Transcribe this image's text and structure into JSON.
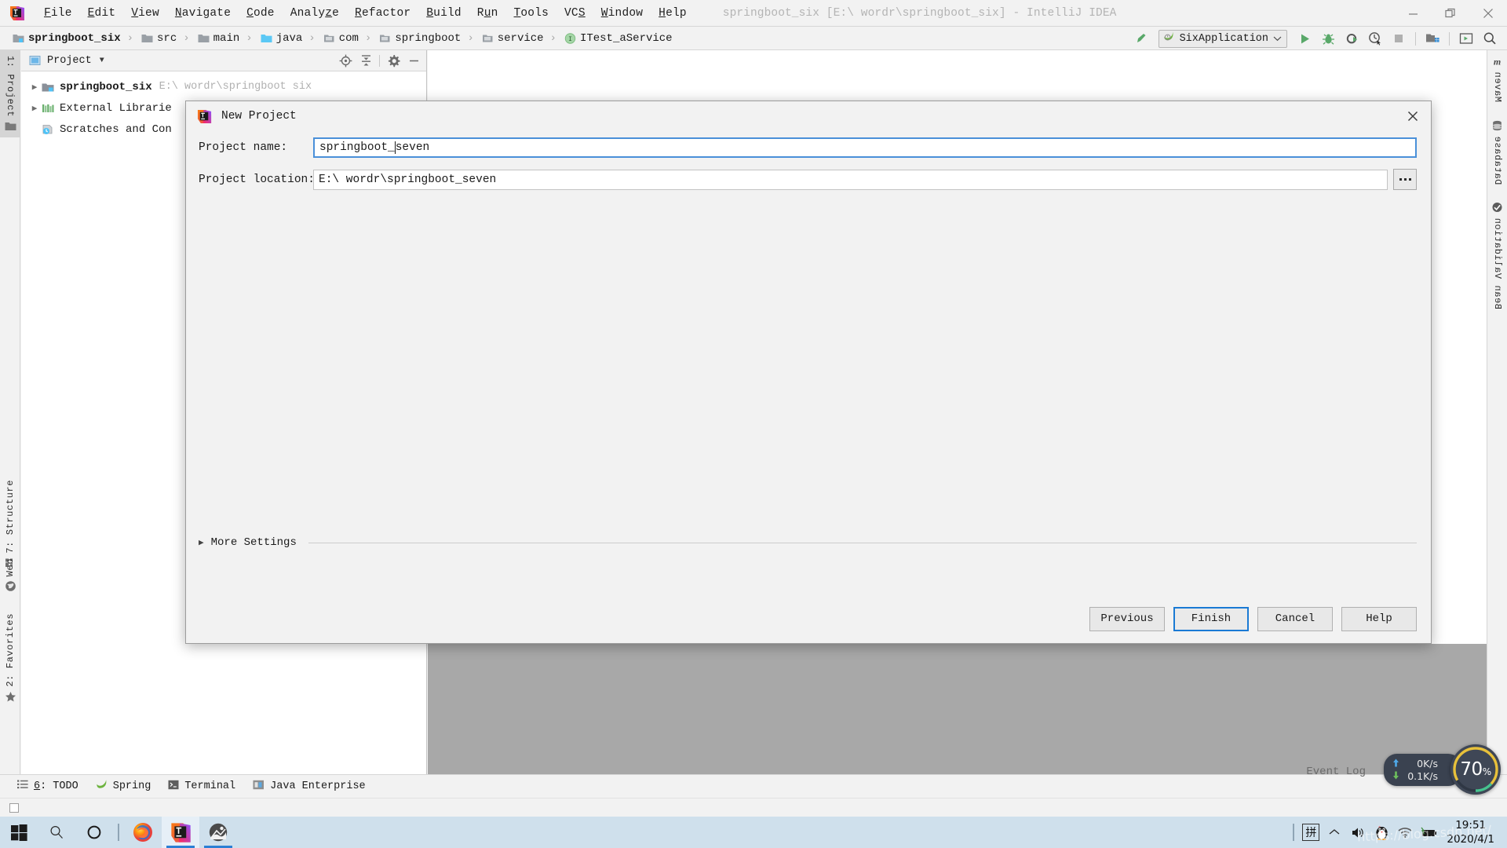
{
  "window": {
    "title": "springboot_six [E:\\ wordr\\springboot_six] - IntelliJ IDEA",
    "minimize_label": "minimize",
    "restore_label": "restore",
    "close_label": "close"
  },
  "menu": {
    "items": [
      {
        "label": "File",
        "mnemonic": "F"
      },
      {
        "label": "Edit",
        "mnemonic": "E"
      },
      {
        "label": "View",
        "mnemonic": "V"
      },
      {
        "label": "Navigate",
        "mnemonic": "N"
      },
      {
        "label": "Code",
        "mnemonic": "C"
      },
      {
        "label": "Analyze",
        "mnemonic": "z"
      },
      {
        "label": "Refactor",
        "mnemonic": "R"
      },
      {
        "label": "Build",
        "mnemonic": "B"
      },
      {
        "label": "Run",
        "mnemonic": "u"
      },
      {
        "label": "Tools",
        "mnemonic": "T"
      },
      {
        "label": "VCS",
        "mnemonic": "S"
      },
      {
        "label": "Window",
        "mnemonic": "W"
      },
      {
        "label": "Help",
        "mnemonic": "H"
      }
    ]
  },
  "breadcrumb": {
    "items": [
      {
        "label": "springboot_six",
        "icon": "project-folder-icon"
      },
      {
        "label": "src",
        "icon": "folder-icon"
      },
      {
        "label": "main",
        "icon": "folder-icon"
      },
      {
        "label": "java",
        "icon": "source-folder-icon"
      },
      {
        "label": "com",
        "icon": "package-icon"
      },
      {
        "label": "springboot",
        "icon": "package-icon"
      },
      {
        "label": "service",
        "icon": "package-icon"
      },
      {
        "label": "ITest_aService",
        "icon": "interface-icon"
      }
    ],
    "separator": "›"
  },
  "toolbar": {
    "build_label": "build-icon",
    "run_configuration": "SixApplication",
    "run_label": "run-icon",
    "debug_label": "debug-icon",
    "run_coverage_label": "run-with-coverage-icon",
    "profile_label": "profiler-icon",
    "stop_label": "stop-icon",
    "project_structure_label": "project-structure-icon",
    "updates_label": "open-tool-window-icon",
    "search_label": "search-everywhere-icon"
  },
  "project_panel": {
    "title": "Project",
    "dropdown": "▼",
    "tools": [
      "locate-icon",
      "collapse-all-icon",
      "settings-gear-icon",
      "hide-icon"
    ],
    "tree": [
      {
        "label": "springboot_six",
        "path": "E:\\ wordr\\springboot six",
        "bold": true,
        "expandable": true,
        "icon": "project-root-icon"
      },
      {
        "label": "External Librarie",
        "path": "",
        "bold": false,
        "expandable": true,
        "icon": "libraries-icon"
      },
      {
        "label": "Scratches and Con",
        "path": "",
        "bold": false,
        "expandable": false,
        "icon": "scratches-icon"
      }
    ]
  },
  "tool_windows": {
    "left_top": [
      {
        "label": "1: Project",
        "icon": "project-tool-icon",
        "active": true
      }
    ],
    "left_bottom": [
      {
        "label": "7: Structure",
        "icon": "structure-icon"
      },
      {
        "label": "Web",
        "icon": "web-icon"
      },
      {
        "label": "2: Favorites",
        "icon": "favorites-star-icon"
      }
    ],
    "right": [
      {
        "label": "Maven",
        "icon": "maven-icon"
      },
      {
        "label": "Database",
        "icon": "database-icon"
      },
      {
        "label": "Bean Validation",
        "icon": "bean-validation-icon"
      }
    ]
  },
  "status_bar": {
    "items": [
      {
        "label": "6: TODO",
        "mnemonic": "6",
        "icon": "todo-icon"
      },
      {
        "label": "Spring",
        "icon": "spring-leaf-icon"
      },
      {
        "label": "Terminal",
        "icon": "terminal-icon"
      },
      {
        "label": "Java Enterprise",
        "icon": "java-enterprise-icon"
      }
    ],
    "event_log": "Event Log"
  },
  "dialog": {
    "title": "New Project",
    "icon": "intellij-icon",
    "close_label": "✕",
    "fields": [
      {
        "label": "Project name:",
        "value": "springboot_seven",
        "value_before_caret": "springboot_",
        "value_after_caret": "seven",
        "focused": true,
        "has_browse": false
      },
      {
        "label": "Project location:",
        "value": "E:\\ wordr\\springboot_seven",
        "focused": false,
        "has_browse": true,
        "browse_label": "..."
      }
    ],
    "more_settings": "More Settings",
    "buttons": [
      {
        "label": "Previous",
        "default": false
      },
      {
        "label": "Finish",
        "default": true
      },
      {
        "label": "Cancel",
        "default": false
      },
      {
        "label": "Help",
        "default": false
      }
    ]
  },
  "net_speed": {
    "upload": "0K/s",
    "download": "0.1K/s",
    "gauge_value": "70",
    "gauge_unit": "%"
  },
  "taskbar": {
    "items": [
      {
        "name": "start-button",
        "icon": "windows-logo-icon"
      },
      {
        "name": "search-button",
        "icon": "search-icon"
      },
      {
        "name": "cortana-button",
        "icon": "cortana-circle-icon"
      },
      {
        "name": "firefox-button",
        "icon": "firefox-icon"
      },
      {
        "name": "intellij-button",
        "icon": "intellij-idea-icon"
      },
      {
        "name": "photos-button",
        "icon": "photo-viewer-icon"
      }
    ],
    "tray": {
      "ime": "拼",
      "show_hidden": "show-hidden-icons",
      "volume": "volume-icon",
      "qq": "qq-penguin-icon",
      "network": "wifi-icon",
      "battery": "battery-icon"
    },
    "clock": {
      "time": "19:51",
      "date": "2020/4/1"
    }
  },
  "watermark": "https://blog.csdn.net/",
  "colors": {
    "accent_blue": "#1a7ad4",
    "focus_border": "#4a90d9",
    "panel_bg": "#f2f2f2",
    "editor_grey": "#a8a8a8",
    "taskbar_bg": "#cfe0ec",
    "run_green": "#50a14f",
    "gauge_bg": "#3f4756"
  }
}
